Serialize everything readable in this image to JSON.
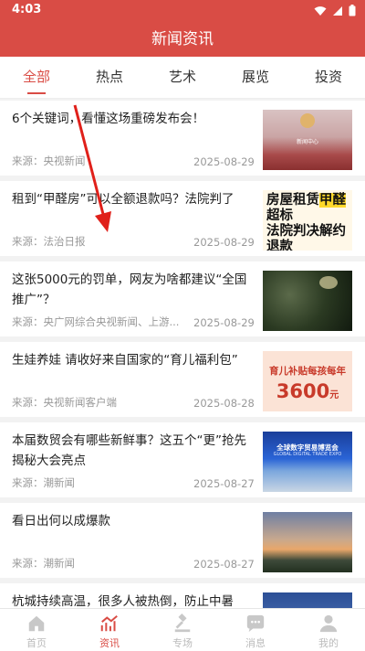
{
  "status": {
    "time": "4:03"
  },
  "appbar": {
    "title": "新闻资讯"
  },
  "tabs": [
    {
      "label": "全部",
      "active": true
    },
    {
      "label": "热点"
    },
    {
      "label": "艺术"
    },
    {
      "label": "展览"
    },
    {
      "label": "投资"
    }
  ],
  "feed": [
    {
      "title": "6个关键词，看懂这场重磅发布会！",
      "source": "来源：央视新闻",
      "date": "2025-08-29",
      "thumb_text": "新闻中心"
    },
    {
      "title": "租到“甲醛房”可以全额退款吗？法院判了",
      "source": "来源：法治日报",
      "date": "2025-08-29",
      "thumb_lines": [
        "房屋租赁",
        "甲醛",
        "超标",
        "法院判决解约",
        "退款"
      ]
    },
    {
      "title": "这张5000元的罚单，网友为啥都建议“全国推广”？",
      "source": "来源：央广网综合央视新闻、上游...",
      "date": "2025-08-29"
    },
    {
      "title": "生娃养娃 请收好来自国家的“育儿福利包”",
      "source": "来源：央视新闻客户端",
      "date": "2025-08-28",
      "thumb_line1": "育儿补贴每孩每年",
      "thumb_line2": "3600",
      "thumb_unit": "元"
    },
    {
      "title": "本届数贸会有哪些新鲜事？这五个“更”抢先揭秘大会亮点",
      "source": "来源：潮新闻",
      "date": "2025-08-27",
      "thumb_line1": "全球数字贸易博览会",
      "thumb_line2": "GLOBAL DIGITAL TRADE EXPO"
    },
    {
      "title": "看日出何以成爆款",
      "source": "来源：潮新闻",
      "date": "2025-08-27"
    },
    {
      "title": "杭城持续高温，很多人被热倒，防止中暑",
      "source": "",
      "date": ""
    }
  ],
  "bottomnav": [
    {
      "label": "首页",
      "icon": "home-icon"
    },
    {
      "label": "资讯",
      "icon": "news-trend-icon",
      "active": true
    },
    {
      "label": "专场",
      "icon": "gavel-icon"
    },
    {
      "label": "消息",
      "icon": "message-icon"
    },
    {
      "label": "我的",
      "icon": "person-icon"
    }
  ],
  "colors": {
    "brand": "#d94c45",
    "inactive": "#bbbbbb",
    "annotation_arrow": "#e0201a"
  }
}
